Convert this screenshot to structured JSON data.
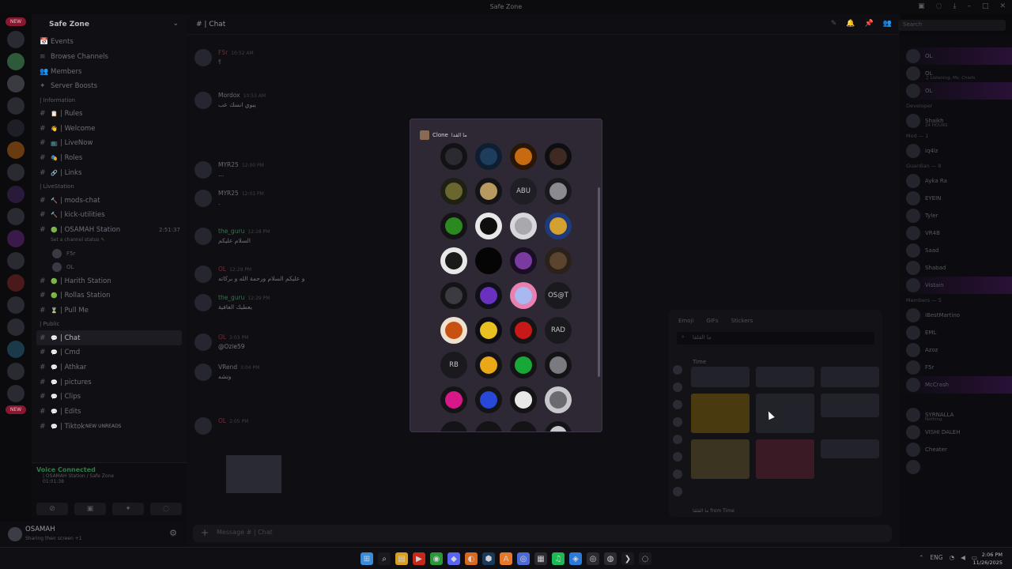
{
  "window": {
    "title": "Safe Zone"
  },
  "server": {
    "name": "Safe Zone"
  },
  "sidebar": {
    "top": [
      {
        "icon": "📅",
        "label": "Events"
      },
      {
        "icon": "≡",
        "label": "Browse Channels"
      },
      {
        "icon": "👥",
        "label": "Members"
      },
      {
        "icon": "✦",
        "label": "Server Boosts"
      }
    ],
    "information_cat": "| Information",
    "information": [
      {
        "icon": "📋",
        "label": "| Rules"
      },
      {
        "icon": "👋",
        "label": "| Welcome"
      },
      {
        "icon": "📺",
        "label": "| LiveNow"
      },
      {
        "icon": "🎭",
        "label": "| Roles"
      },
      {
        "icon": "🔗",
        "label": "| Links"
      }
    ],
    "livestation_cat": "| LiveStation",
    "livestation": [
      {
        "icon": "🔨",
        "label": "| mods-chat"
      },
      {
        "icon": "🔨",
        "label": "| kick-utilities"
      },
      {
        "icon": "🟢",
        "label": "| OSAMAH Station",
        "time": "2:51:37"
      }
    ],
    "voice_status": "Set a channel status ✎",
    "voice_users": [
      {
        "name": "F5r"
      },
      {
        "name": "OL"
      }
    ],
    "more_voice": [
      {
        "icon": "🟢",
        "label": "| Harith Station"
      },
      {
        "icon": "🟢",
        "label": "| Rollas Station"
      },
      {
        "icon": "⏳",
        "label": "| Pull Me"
      }
    ],
    "public_cat": "| Public",
    "public": [
      {
        "icon": "💬",
        "label": "| Chat",
        "active": true
      },
      {
        "icon": "💬",
        "label": "| Cmd"
      },
      {
        "icon": "💬",
        "label": "| Athkar"
      },
      {
        "icon": "💬",
        "label": "| pictures"
      },
      {
        "icon": "💬",
        "label": "| Clips"
      },
      {
        "icon": "💬",
        "label": "| Edits"
      },
      {
        "icon": "💬",
        "label": "| Tiktok",
        "unread": "NEW UNREADS"
      }
    ]
  },
  "voice_panel": {
    "title": "Voice Connected",
    "sub": "| OSAMAH Station / Safe Zone",
    "time": "01:01:38"
  },
  "user": {
    "name": "OSAMAH",
    "status": "Sharing their screen +1"
  },
  "chat": {
    "channel": "| Chat",
    "search": "Search",
    "messages": [
      {
        "author": "F5r",
        "time": "10:52 AM",
        "text": "؟",
        "color": "red"
      },
      {
        "author": "Mordox",
        "time": "10:53 AM",
        "text": "يبوي انسك عب",
        "color": ""
      },
      {
        "author": "MYR25",
        "time": "12:00 PM",
        "text": "...",
        "color": ""
      },
      {
        "author": "MYR25",
        "time": "12:01 PM",
        "text": ".",
        "color": ""
      },
      {
        "author": "the_guru",
        "time": "12:28 PM",
        "text": "السلام عليكم",
        "color": "grn"
      },
      {
        "author": "OL",
        "time": "12:29 PM",
        "text": "و عليكم السلام ورحمة الله و بركاته",
        "color": "red"
      },
      {
        "author": "the_guru",
        "time": "12:29 PM",
        "text": "يعطيك العافية",
        "color": "grn"
      },
      {
        "author": "OL",
        "time": "2:03 PM",
        "text": "@Ozie59",
        "color": "red"
      },
      {
        "author": "VRend",
        "time": "3:04 PM",
        "text": "وتشه",
        "color": ""
      },
      {
        "author": "OL",
        "time": "2:05 PM",
        "text": "",
        "color": "red"
      }
    ],
    "composer_placeholder": "Message # | Chat"
  },
  "members": {
    "groups": [
      {
        "header": "",
        "rows": [
          {
            "name": "OL",
            "sub": "",
            "glow": true
          },
          {
            "name": "OL",
            "sub": "♫ Listening, Ms. Chiefs",
            "glow": false
          },
          {
            "name": "OL",
            "sub": "",
            "glow": true
          }
        ]
      },
      {
        "header": "Developer",
        "rows": [
          {
            "name": "Shaikh",
            "sub": "24 HOURS",
            "glow": false
          }
        ]
      },
      {
        "header": "Mod — 1",
        "rows": [
          {
            "name": "iq4lz",
            "sub": "",
            "glow": false
          }
        ]
      },
      {
        "header": "Guardian — 8",
        "rows": [
          {
            "name": "Ayka Ra",
            "sub": "",
            "glow": false
          },
          {
            "name": "EYEIN",
            "sub": "",
            "glow": false
          },
          {
            "name": "Tyler",
            "sub": "",
            "glow": false
          },
          {
            "name": "VR4B",
            "sub": "",
            "glow": false
          },
          {
            "name": "Saad",
            "sub": "",
            "glow": false
          },
          {
            "name": "Shabad",
            "sub": "",
            "glow": false
          },
          {
            "name": "Vistain",
            "sub": "",
            "glow": true
          }
        ]
      },
      {
        "header": "Members — 5",
        "rows": [
          {
            "name": "iBestMartino",
            "sub": "",
            "glow": false
          },
          {
            "name": "EML",
            "sub": "",
            "glow": false
          },
          {
            "name": "Azoz",
            "sub": "",
            "glow": false
          },
          {
            "name": "F5r",
            "sub": "",
            "glow": false
          },
          {
            "name": "McCrash",
            "sub": "",
            "glow": true
          }
        ]
      },
      {
        "header": "",
        "rows": [
          {
            "name": "SYRNALLA",
            "sub": "Nothing",
            "glow": false
          },
          {
            "name": "VISHI DALEH",
            "sub": "",
            "glow": false
          },
          {
            "name": "Cheater",
            "sub": "",
            "glow": false
          },
          {
            "name": "",
            "sub": "",
            "glow": false
          }
        ]
      }
    ]
  },
  "emoji_picker": {
    "tabs": [
      "Emoji",
      "GIFs",
      "Stickers"
    ],
    "search": "ما القلقا",
    "section": "Time",
    "footer": "ما القلقا from Time"
  },
  "modal": {
    "title": "Clone",
    "title_ar": "ما القدا",
    "avatars": [
      {
        "label": "",
        "bg": "#121214",
        "mk": "#2a2a30"
      },
      {
        "label": "",
        "bg": "#0e1e30",
        "mk": "#1e3c5c"
      },
      {
        "label": "",
        "bg": "#2a1606",
        "mk": "#c86a10"
      },
      {
        "label": "",
        "bg": "#0e0e12",
        "mk": "#3e2a20"
      },
      {
        "label": "",
        "bg": "#1e2014",
        "mk": "#6a6630"
      },
      {
        "label": "",
        "bg": "#141416",
        "mk": "#b89a60"
      },
      {
        "label": "ABU",
        "bg": "#1e1e24",
        "mk": ""
      },
      {
        "label": "",
        "bg": "#1a1a1e",
        "mk": "#8a8a90"
      },
      {
        "label": "",
        "bg": "#141416",
        "mk": "#2a8a20"
      },
      {
        "label": "",
        "bg": "#e8e8e8",
        "mk": "#0e0e0e"
      },
      {
        "label": "",
        "bg": "#d8d8dc",
        "mk": "#a8a8ae"
      },
      {
        "label": "",
        "bg": "#1e3a7a",
        "mk": "#d4a030"
      },
      {
        "label": "",
        "bg": "#e8e8e8",
        "mk": "#1a1a1a"
      },
      {
        "label": "",
        "bg": "#050505",
        "mk": "#050505"
      },
      {
        "label": "",
        "bg": "#1a0e24",
        "mk": "#7a3aa0"
      },
      {
        "label": "",
        "bg": "#2a2218",
        "mk": "#5a4430"
      },
      {
        "label": "",
        "bg": "#141416",
        "mk": "#3a3a40"
      },
      {
        "label": "",
        "bg": "#101018",
        "mk": "#6a30c0"
      },
      {
        "label": "",
        "bg": "#e880b0",
        "mk": "#a8b8f0"
      },
      {
        "label": "OS@T",
        "bg": "#1a1a1e",
        "mk": ""
      },
      {
        "label": "",
        "bg": "#f0e0d0",
        "mk": "#c85010"
      },
      {
        "label": "",
        "bg": "#0e0e12",
        "mk": "#e8c020"
      },
      {
        "label": "",
        "bg": "#141416",
        "mk": "#c81818"
      },
      {
        "label": "RAD",
        "bg": "#1a1a1e",
        "mk": ""
      },
      {
        "label": "RB",
        "bg": "#1a1a1e",
        "mk": ""
      },
      {
        "label": "",
        "bg": "#141416",
        "mk": "#e8a818"
      },
      {
        "label": "",
        "bg": "#141416",
        "mk": "#18a838"
      },
      {
        "label": "",
        "bg": "#141416",
        "mk": "#7a7a80"
      },
      {
        "label": "",
        "bg": "#141416",
        "mk": "#d81888"
      },
      {
        "label": "",
        "bg": "#141416",
        "mk": "#2848d8"
      },
      {
        "label": "",
        "bg": "#141416",
        "mk": "#e8e8e8"
      },
      {
        "label": "",
        "bg": "#c8c8cc",
        "mk": "#6a6a70"
      },
      {
        "label": "",
        "bg": "#141416",
        "mk": ""
      },
      {
        "label": "",
        "bg": "#141416",
        "mk": ""
      },
      {
        "label": "",
        "bg": "#141416",
        "mk": ""
      },
      {
        "label": "",
        "bg": "#141416",
        "mk": "#c8c8cc"
      }
    ]
  },
  "taskbar": {
    "apps": [
      {
        "glyph": "⊞",
        "color": "#3a8ad8"
      },
      {
        "glyph": "⌕",
        "color": "#1a1a1e"
      },
      {
        "glyph": "▤",
        "color": "#d8a020"
      },
      {
        "glyph": "▶",
        "color": "#c82818"
      },
      {
        "glyph": "◉",
        "color": "#2a9838"
      },
      {
        "glyph": "◆",
        "color": "#5865f2"
      },
      {
        "glyph": "◐",
        "color": "#d86a20"
      },
      {
        "glyph": "⬢",
        "color": "#1a3a5a"
      },
      {
        "glyph": "A",
        "color": "#e87828"
      },
      {
        "glyph": "◎",
        "color": "#4a6ad8"
      },
      {
        "glyph": "▦",
        "color": "#2a2a30"
      },
      {
        "glyph": "♫",
        "color": "#1db954"
      },
      {
        "glyph": "◈",
        "color": "#2a7ad8"
      },
      {
        "glyph": "◎",
        "color": "#2a2a30"
      },
      {
        "glyph": "◍",
        "color": "#2a2a30"
      },
      {
        "glyph": "❯",
        "color": "#1a1a1e"
      },
      {
        "glyph": "◌",
        "color": "#1a1a1e"
      }
    ],
    "lang": "ENG",
    "time": "2:06 PM",
    "date": "11/26/2025"
  }
}
